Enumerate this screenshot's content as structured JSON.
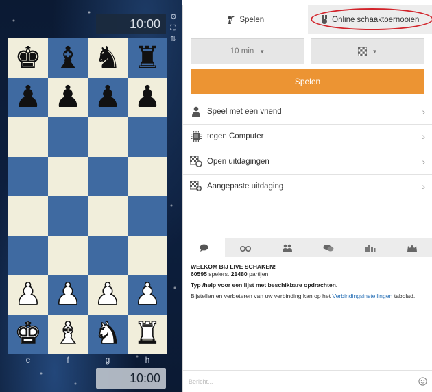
{
  "clocks": {
    "top": "10:00",
    "bottom": "10:00"
  },
  "board": {
    "rows": [
      [
        {
          "p": "♚",
          "c": "black"
        },
        {
          "p": "♝",
          "c": "black"
        },
        {
          "p": "♞",
          "c": "black"
        },
        {
          "p": "♜",
          "c": "black"
        }
      ],
      [
        {
          "p": "♟",
          "c": "black"
        },
        {
          "p": "♟",
          "c": "black"
        },
        {
          "p": "♟",
          "c": "black"
        },
        {
          "p": "♟",
          "c": "black"
        }
      ],
      [
        {
          "p": "",
          "c": ""
        },
        {
          "p": "",
          "c": ""
        },
        {
          "p": "",
          "c": ""
        },
        {
          "p": "",
          "c": ""
        }
      ],
      [
        {
          "p": "",
          "c": ""
        },
        {
          "p": "",
          "c": ""
        },
        {
          "p": "",
          "c": ""
        },
        {
          "p": "",
          "c": ""
        }
      ],
      [
        {
          "p": "",
          "c": ""
        },
        {
          "p": "",
          "c": ""
        },
        {
          "p": "",
          "c": ""
        },
        {
          "p": "",
          "c": ""
        }
      ],
      [
        {
          "p": "",
          "c": ""
        },
        {
          "p": "",
          "c": ""
        },
        {
          "p": "",
          "c": ""
        },
        {
          "p": "",
          "c": ""
        }
      ],
      [
        {
          "p": "♟",
          "c": "white"
        },
        {
          "p": "♟",
          "c": "white"
        },
        {
          "p": "♟",
          "c": "white"
        },
        {
          "p": "♟",
          "c": "white"
        }
      ],
      [
        {
          "p": "♚",
          "c": "white"
        },
        {
          "p": "♝",
          "c": "white"
        },
        {
          "p": "♞",
          "c": "white"
        },
        {
          "p": "♜",
          "c": "white"
        }
      ]
    ],
    "files": [
      "e",
      "f",
      "g",
      "h"
    ]
  },
  "tabs": {
    "play": "Spelen",
    "tournaments": "Online schaaktoernooien"
  },
  "selects": {
    "time": "10 min",
    "type_icon": "checkerboard-icon"
  },
  "play_button": "Spelen",
  "menu": [
    {
      "label": "Speel met een vriend",
      "icon": "person-icon"
    },
    {
      "label": "tegen Computer",
      "icon": "chip-icon"
    },
    {
      "label": "Open uitdagingen",
      "icon": "checkerboard-icon"
    },
    {
      "label": "Aangepaste uitdaging",
      "icon": "checkerboard-plus-icon"
    }
  ],
  "chat_tabs": [
    "chat-bubble-icon",
    "binoculars-icon",
    "people-icon",
    "conversation-icon",
    "city-icon",
    "crown-icon"
  ],
  "chat": {
    "welcome": "WELKOM BIJ LIVE SCHAKEN!",
    "players_count": "60595",
    "players_text": " spelers. ",
    "games_count": "21480",
    "games_text": " partijen.",
    "help_line": "Typ /help voor een lijst met beschikbare opdrachten.",
    "connection_text": "Bijstellen en verbeteren van uw verbinding kan op het ",
    "connection_link": "Verbindingsinstellingen",
    "connection_suffix": " tabblad."
  },
  "chat_input": {
    "placeholder": "Bericht..."
  },
  "colors": {
    "accent": "#ec9433",
    "board_dark": "#3f6aa1",
    "board_light": "#f1eedb",
    "highlight_ring": "#d2232a",
    "link": "#2e74b8"
  }
}
